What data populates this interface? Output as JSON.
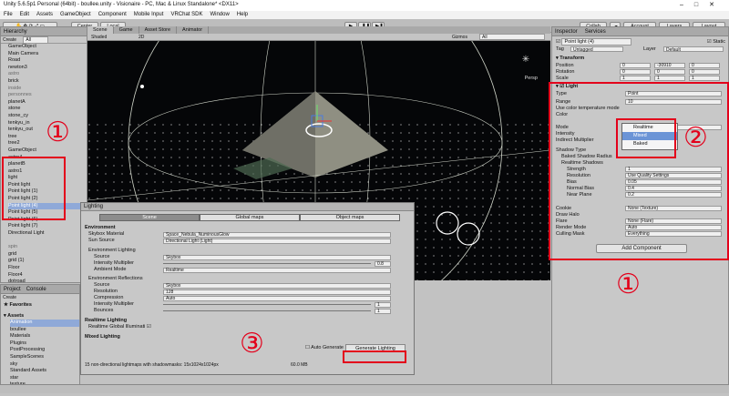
{
  "window": {
    "title": "Unity 5.6.5p1 Personal (64bit) - boullee.unity - Visionaire - PC, Mac & Linux Standalone* <DX11>"
  },
  "menu": [
    "File",
    "Edit",
    "Assets",
    "GameObject",
    "Component",
    "Mobile Input",
    "VRChat SDK",
    "Window",
    "Help"
  ],
  "toolbar": {
    "center": "Center",
    "local": "Local",
    "collab": "Collab",
    "account": "Account",
    "layers": "Layers",
    "layout": "Layout"
  },
  "hierarchy": {
    "tab": "Hierarchy",
    "create": "Create",
    "search": "All",
    "rows": [
      {
        "t": "GameObject",
        "c": ""
      },
      {
        "t": "Main Camera",
        "c": ""
      },
      {
        "t": "Road",
        "c": ""
      },
      {
        "t": "newton3",
        "c": ""
      },
      {
        "t": "astro",
        "c": "grey"
      },
      {
        "t": "brick",
        "c": ""
      },
      {
        "t": "inside",
        "c": "grey"
      },
      {
        "t": "personnes",
        "c": "grey"
      },
      {
        "t": "planetA",
        "c": ""
      },
      {
        "t": "stone",
        "c": ""
      },
      {
        "t": "stone_cy",
        "c": ""
      },
      {
        "t": "tenkyu_in",
        "c": ""
      },
      {
        "t": "tenkyu_out",
        "c": ""
      },
      {
        "t": "tree",
        "c": ""
      },
      {
        "t": "tree2",
        "c": ""
      },
      {
        "t": "GameObject",
        "c": ""
      },
      {
        "t": "astro4",
        "c": ""
      },
      {
        "t": "planetB",
        "c": ""
      },
      {
        "t": "astro1",
        "c": ""
      },
      {
        "t": "light",
        "c": ""
      },
      {
        "t": "Point light",
        "c": ""
      },
      {
        "t": "Point light (1)",
        "c": ""
      },
      {
        "t": "Point light (2)",
        "c": ""
      },
      {
        "t": "Point light (4)",
        "c": "sel"
      },
      {
        "t": "Point light (5)",
        "c": ""
      },
      {
        "t": "Point light (6)",
        "c": ""
      },
      {
        "t": "Point light (7)",
        "c": ""
      },
      {
        "t": "Directional Light",
        "c": ""
      },
      {
        "t": "",
        "c": ""
      },
      {
        "t": "spin",
        "c": "grey"
      },
      {
        "t": "grid",
        "c": ""
      },
      {
        "t": "grid (1)",
        "c": ""
      },
      {
        "t": "Floor",
        "c": ""
      },
      {
        "t": "Floor4",
        "c": ""
      },
      {
        "t": "dotroad",
        "c": ""
      },
      {
        "t": "dotroad (1)",
        "c": ""
      },
      {
        "t": "to3f",
        "c": ""
      },
      {
        "t": "map",
        "c": ""
      }
    ]
  },
  "project": {
    "tabs": [
      "Project",
      "Console"
    ],
    "create": "Create",
    "favorites": "Favorites",
    "assets": "Assets",
    "folders": [
      "Animation",
      "boullee",
      "Materials",
      "Plugins",
      "PostProcessing",
      "SampleScenes",
      "sky",
      "Standard Assets",
      "star",
      "texture",
      "VRCSDK"
    ]
  },
  "scene": {
    "tabs": [
      "Scene",
      "Game",
      "Asset Store",
      "Animator"
    ],
    "shading": "Shaded",
    "mode": "2D",
    "gizmos": "Gizmos",
    "search": "All",
    "persp": "Persp"
  },
  "inspector": {
    "tabs": [
      "Inspector",
      "Services"
    ],
    "name": "Point light (4)",
    "static": "Static",
    "tag_label": "Tag",
    "tag": "Untagged",
    "layer_label": "Layer",
    "layer": "Default",
    "transform": "Transform",
    "position": {
      "label": "Position",
      "x": "0",
      "y": "-30910",
      "z": "0"
    },
    "rotation": {
      "label": "Rotation",
      "x": "0",
      "y": "0",
      "z": "0"
    },
    "scale": {
      "label": "Scale",
      "x": "1",
      "y": "1",
      "z": "1"
    },
    "light": "Light",
    "fields": [
      {
        "label": "Type",
        "value": "Point"
      },
      {
        "label": "Range",
        "value": "10"
      },
      {
        "label": "Use color temperature mode",
        "value": ""
      },
      {
        "label": "Color",
        "value": ""
      },
      {
        "label": "Mode",
        "value": "Mixed"
      },
      {
        "label": "Intensity",
        "value": ""
      },
      {
        "label": "Indirect Multiplier",
        "value": ""
      },
      {
        "label": "Shadow Type",
        "value": ""
      },
      {
        "label": "Baked Shadow Radius",
        "value": ""
      },
      {
        "label": "Realtime Shadows",
        "value": ""
      },
      {
        "label": "Strength",
        "value": "1"
      },
      {
        "label": "Resolution",
        "value": "Use Quality Settings"
      },
      {
        "label": "Bias",
        "value": "0.05"
      },
      {
        "label": "Normal Bias",
        "value": "0.4"
      },
      {
        "label": "Near Plane",
        "value": "0.2"
      },
      {
        "label": "Cookie",
        "value": "None (Texture)"
      },
      {
        "label": "Draw Halo",
        "value": ""
      },
      {
        "label": "Flare",
        "value": "None (Flare)"
      },
      {
        "label": "Render Mode",
        "value": "Auto"
      },
      {
        "label": "Culling Mask",
        "value": "Everything"
      }
    ],
    "mode_options": [
      "Realtime",
      "Mixed",
      "Baked"
    ],
    "add_component": "Add Component"
  },
  "lighting": {
    "title": "Lighting",
    "tabs": [
      "Scene",
      "Global maps",
      "Object maps"
    ],
    "environment": "Environment",
    "skybox_label": "Skybox Material",
    "skybox": "Space_Nebula_NuminousGlow",
    "sun_label": "Sun Source",
    "sun": "Directional Light (Light)",
    "env_lighting": "Environment Lighting",
    "source_label": "Source",
    "source": "Skybox",
    "intensity_label": "Intensity Multiplier",
    "intensity": "0.8",
    "ambient_label": "Ambient Mode",
    "ambient": "Realtime",
    "env_reflections": "Environment Reflections",
    "ref_source_label": "Source",
    "ref_source": "Skybox",
    "resolution_label": "Resolution",
    "resolution": "128",
    "compression_label": "Compression",
    "compression": "Auto",
    "ref_intensity_label": "Intensity Multiplier",
    "ref_intensity": "1",
    "bounces_label": "Bounces",
    "bounces": "1",
    "realtime_lighting": "Realtime Lighting",
    "realtime_gi": "Realtime Global Illuminati",
    "mixed_lighting": "Mixed Lighting",
    "auto_generate": "Auto Generate",
    "generate": "Generate Lighting",
    "status": "15 non-directional lightmaps with shadowmasks: 15x1024x1024px",
    "size": "60.0 MB"
  },
  "annotations": {
    "one": "①",
    "two": "②",
    "three": "③"
  },
  "colors": {
    "annotation": "#e3001b",
    "selection": "#8fa9d8",
    "scene_bg": "#050608"
  }
}
